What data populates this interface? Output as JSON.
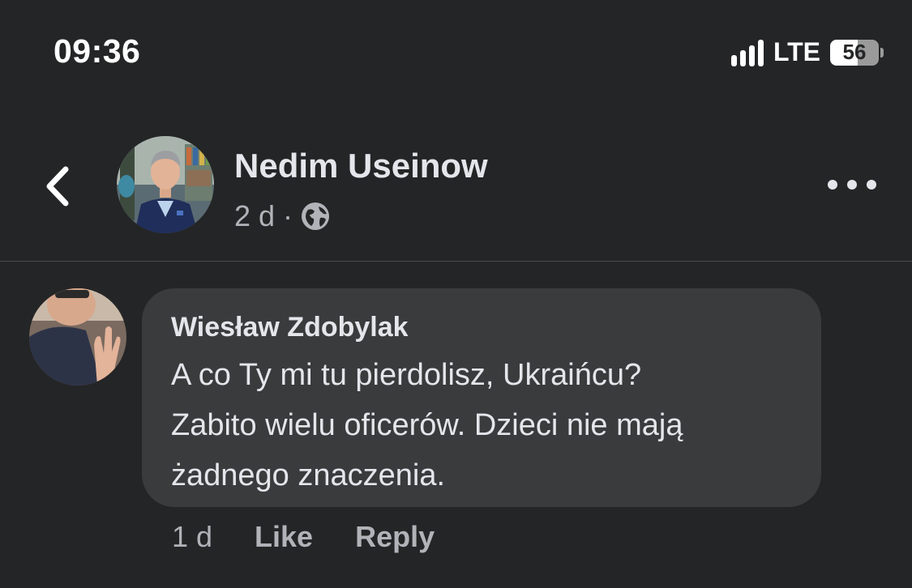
{
  "status_bar": {
    "time": "09:36",
    "network": "LTE",
    "battery_percent": "56",
    "battery_level": 0.56,
    "icons": [
      "signal-icon",
      "battery-icon"
    ]
  },
  "header": {
    "back_icon": "chevron-left-icon",
    "author_name": "Nedim Useinow",
    "post_age": "2 d",
    "separator": "·",
    "audience_icon": "globe-icon",
    "more_icon": "more-dots-icon"
  },
  "comment": {
    "author_name": "Wiesław Zdobylak",
    "text_lines": [
      "A co Ty mi tu pierdolisz, Ukraińcu?",
      "Zabito wielu oficerów. Dzieci nie mają",
      "żadnego znaczenia."
    ],
    "age": "1 d",
    "like_label": "Like",
    "reply_label": "Reply"
  },
  "colors": {
    "background": "#242526",
    "bubble": "#3a3b3c",
    "primary_text": "#e4e6eb",
    "secondary_text": "#b0b3b8"
  }
}
